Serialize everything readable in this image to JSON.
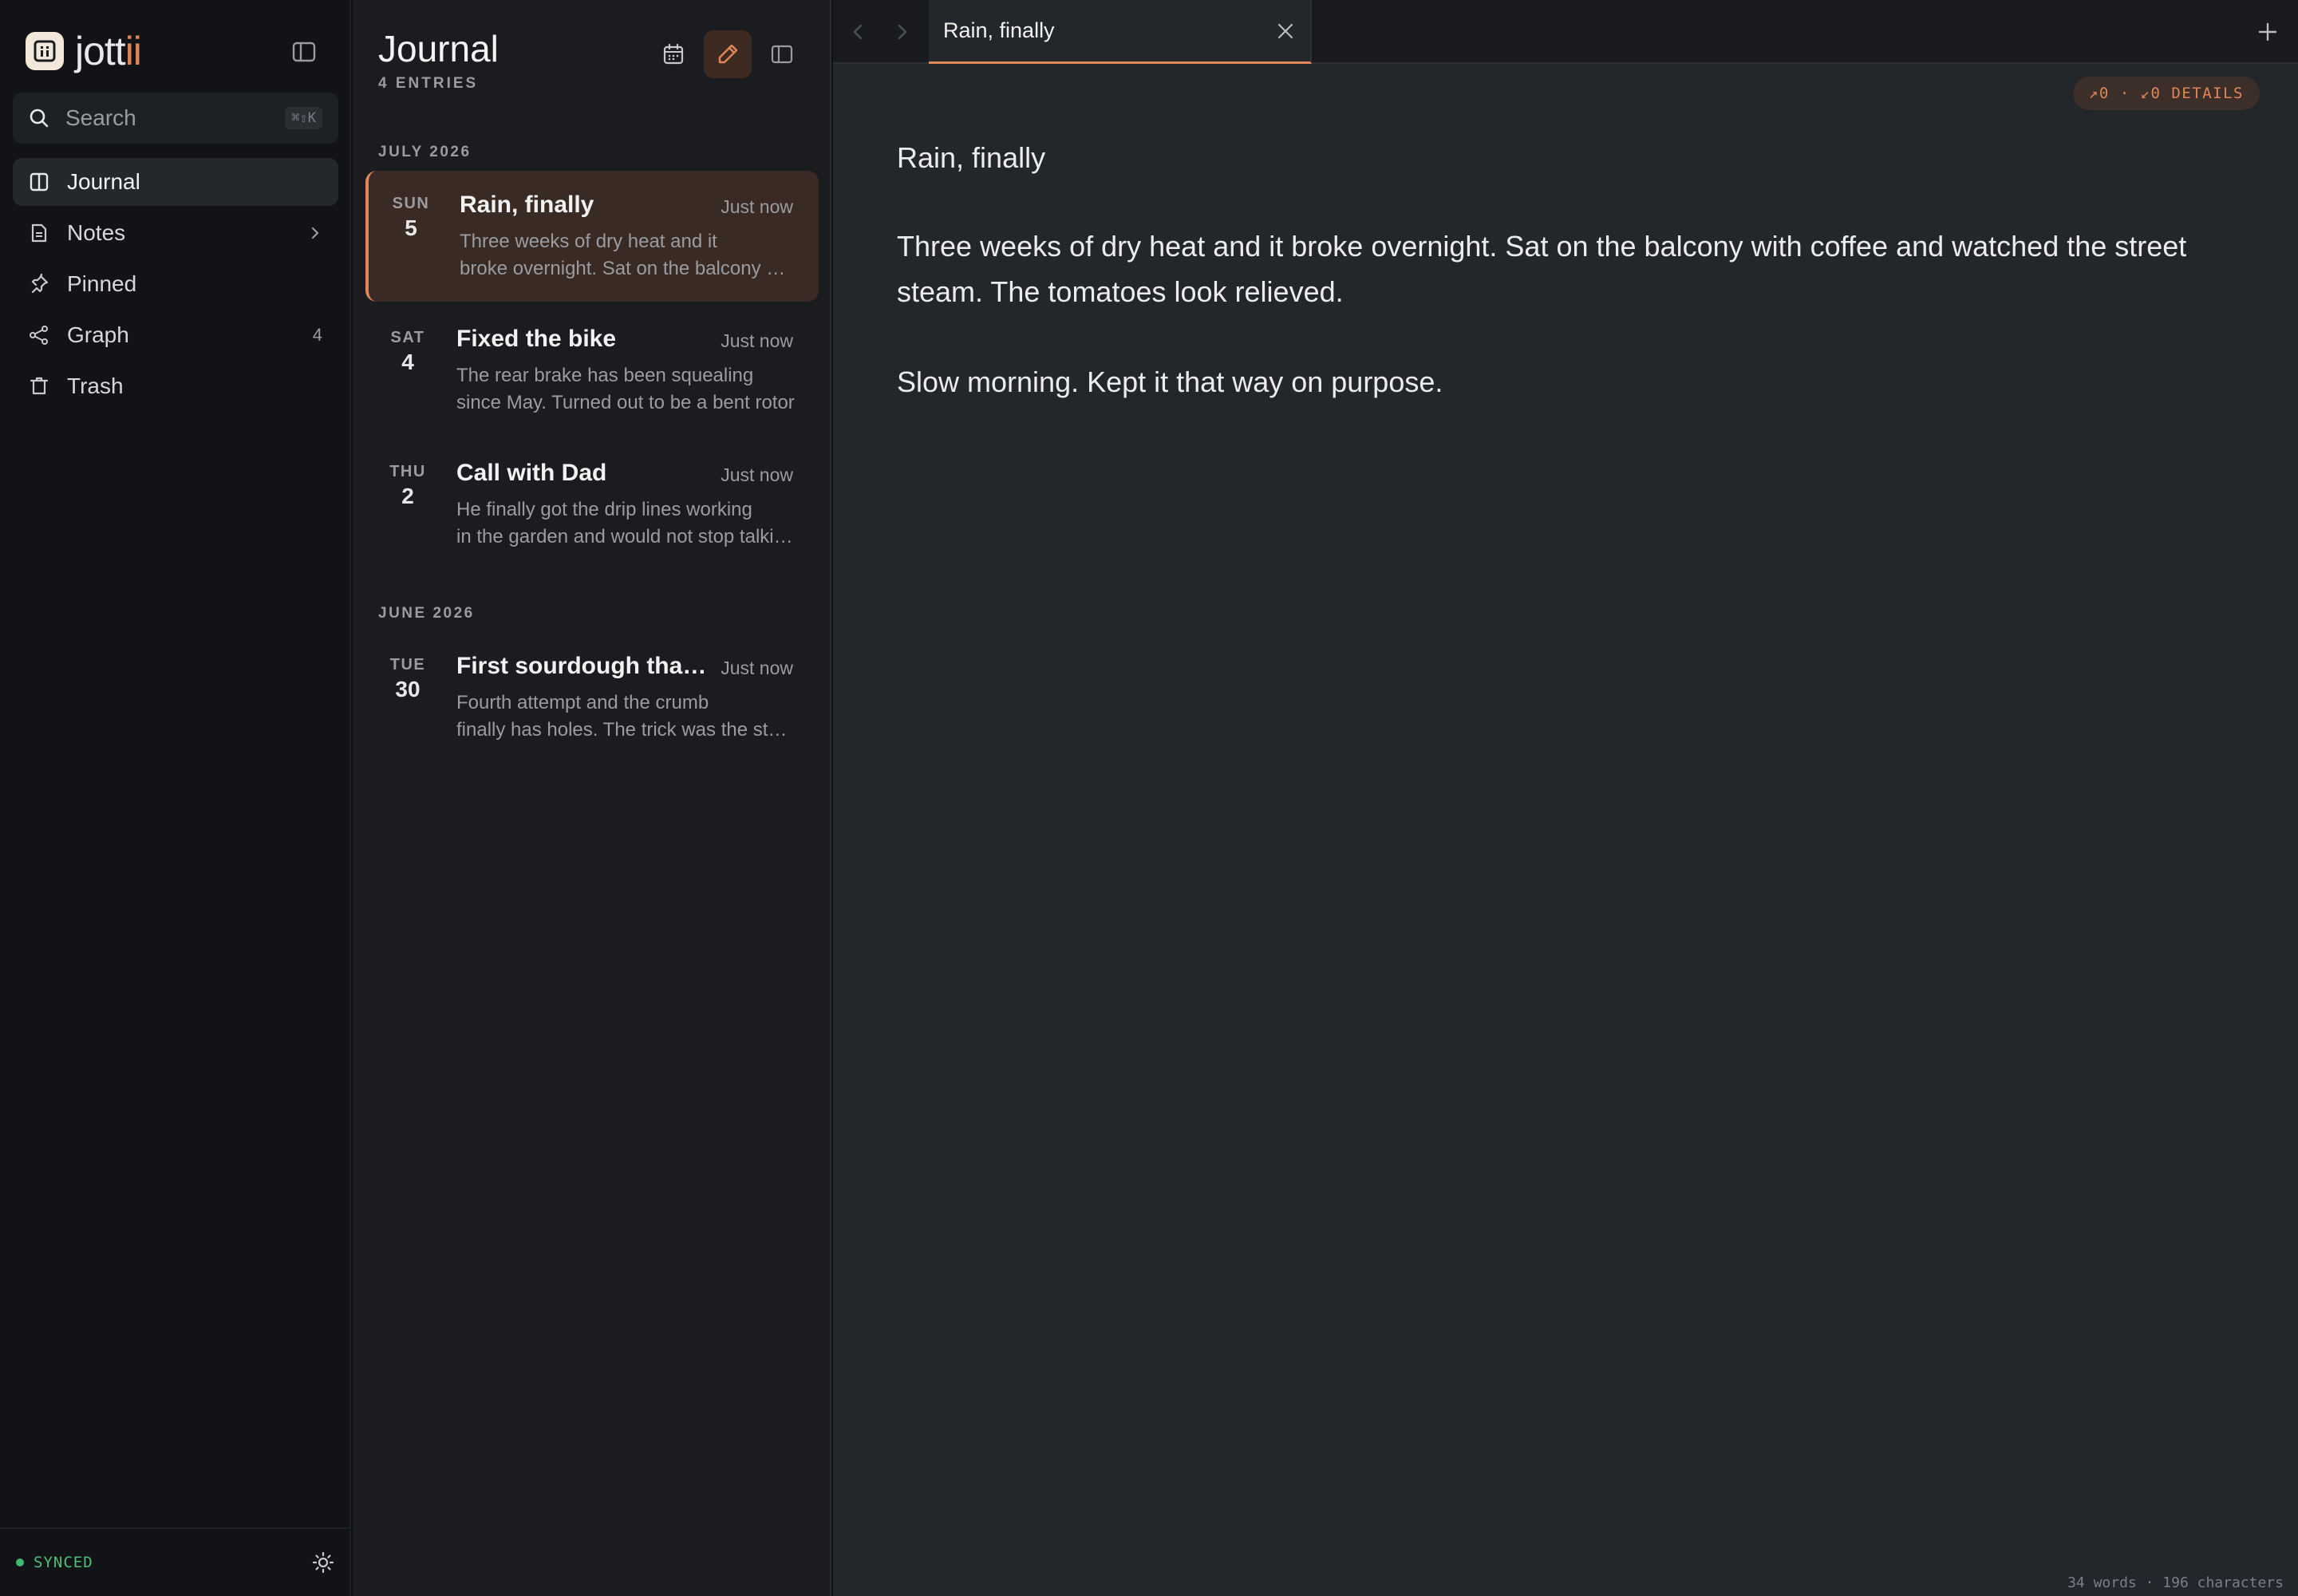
{
  "app": {
    "logo_text": "jott",
    "logo_accent": "ii",
    "accent_color": "#e0865a"
  },
  "search": {
    "placeholder": "Search",
    "shortcut": "⌘⇧K"
  },
  "sidebar": {
    "items": [
      {
        "label": "Journal",
        "icon": "journal-icon",
        "active": true
      },
      {
        "label": "Notes",
        "icon": "notes-icon",
        "has_chevron": true
      },
      {
        "label": "Pinned",
        "icon": "pin-icon"
      },
      {
        "label": "Graph",
        "icon": "graph-icon",
        "count": "4"
      },
      {
        "label": "Trash",
        "icon": "trash-icon"
      }
    ],
    "status": "SYNCED"
  },
  "list": {
    "title": "Journal",
    "subtitle": "4 ENTRIES",
    "groups": [
      {
        "month": "JULY 2026",
        "entries": [
          {
            "dow": "SUN",
            "day": "5",
            "title": "Rain, finally",
            "time": "Just now",
            "preview_1": "Three weeks of dry heat and it",
            "preview_2": "broke overnight. Sat on the balcony with coffee",
            "selected": true
          },
          {
            "dow": "SAT",
            "day": "4",
            "title": "Fixed the bike",
            "time": "Just now",
            "preview_1": "The rear brake has been squealing",
            "preview_2": "since May. Turned out to be a bent rotor"
          },
          {
            "dow": "THU",
            "day": "2",
            "title": "Call with Dad",
            "time": "Just now",
            "preview_1": "He finally got the drip lines working",
            "preview_2": "in the garden and would not stop talking"
          }
        ]
      },
      {
        "month": "JUNE 2026",
        "entries": [
          {
            "dow": "TUE",
            "day": "30",
            "title": "First sourdough that worked",
            "time": "Just now",
            "preview_1": "Fourth attempt and the crumb",
            "preview_2": "finally has holes. The trick was the starter"
          }
        ]
      }
    ]
  },
  "editor": {
    "tab_label": "Rain, finally",
    "links_badge": "↗0 · ↙0 DETAILS",
    "doc_title": "Rain, finally",
    "paragraphs": [
      "Three weeks of dry heat and it broke overnight. Sat on the balcony with coffee and watched the street steam. The tomatoes look relieved.",
      "Slow morning. Kept it that way on purpose."
    ],
    "status": "34 words · 196 characters"
  }
}
